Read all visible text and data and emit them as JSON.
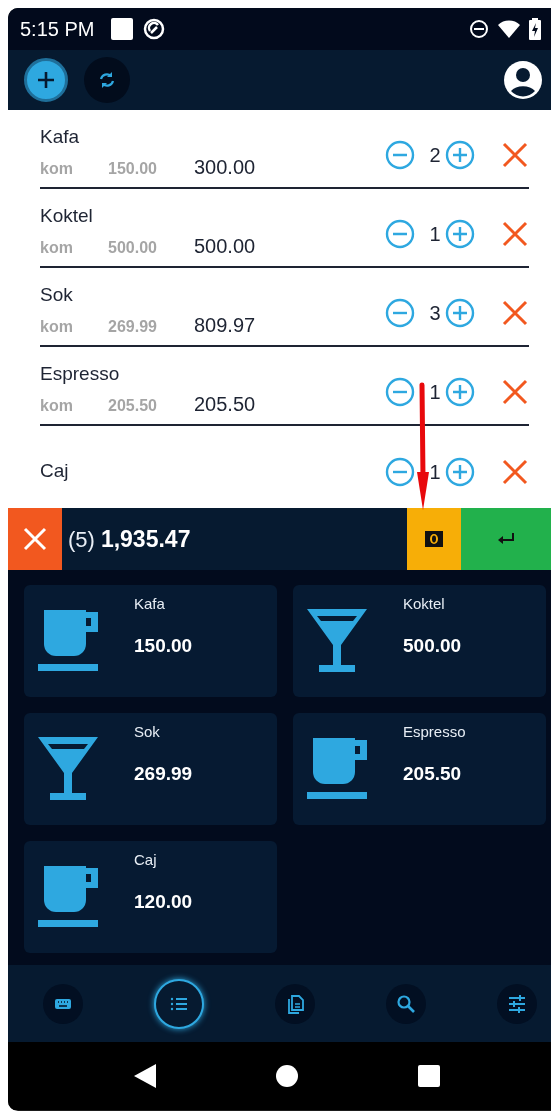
{
  "status_bar": {
    "time": "5:15 PM"
  },
  "order_items": [
    {
      "name": "Kafa",
      "unit": "kom",
      "price": "150.00",
      "total": "300.00",
      "quantity": "2"
    },
    {
      "name": "Koktel",
      "unit": "kom",
      "price": "500.00",
      "total": "500.00",
      "quantity": "1"
    },
    {
      "name": "Sok",
      "unit": "kom",
      "price": "269.99",
      "total": "809.97",
      "quantity": "3"
    },
    {
      "name": "Espresso",
      "unit": "kom",
      "price": "205.50",
      "total": "205.50",
      "quantity": "1"
    },
    {
      "name": "Caj",
      "quantity": "1"
    }
  ],
  "total_bar": {
    "count": "(5)",
    "amount": "1,935.47"
  },
  "products": [
    {
      "name": "Kafa",
      "price": "150.00",
      "kind": "cup"
    },
    {
      "name": "Koktel",
      "price": "500.00",
      "kind": "glass"
    },
    {
      "name": "Sok",
      "price": "269.99",
      "kind": "glass"
    },
    {
      "name": "Espresso",
      "price": "205.50",
      "kind": "cup"
    },
    {
      "name": "Caj",
      "price": "120.00",
      "kind": "cup"
    }
  ],
  "bottom_nav": [
    {
      "kind": "keyboard",
      "selected": false
    },
    {
      "kind": "list",
      "selected": true
    },
    {
      "kind": "document",
      "selected": false
    },
    {
      "kind": "search",
      "selected": false
    },
    {
      "kind": "sliders",
      "selected": false
    }
  ]
}
